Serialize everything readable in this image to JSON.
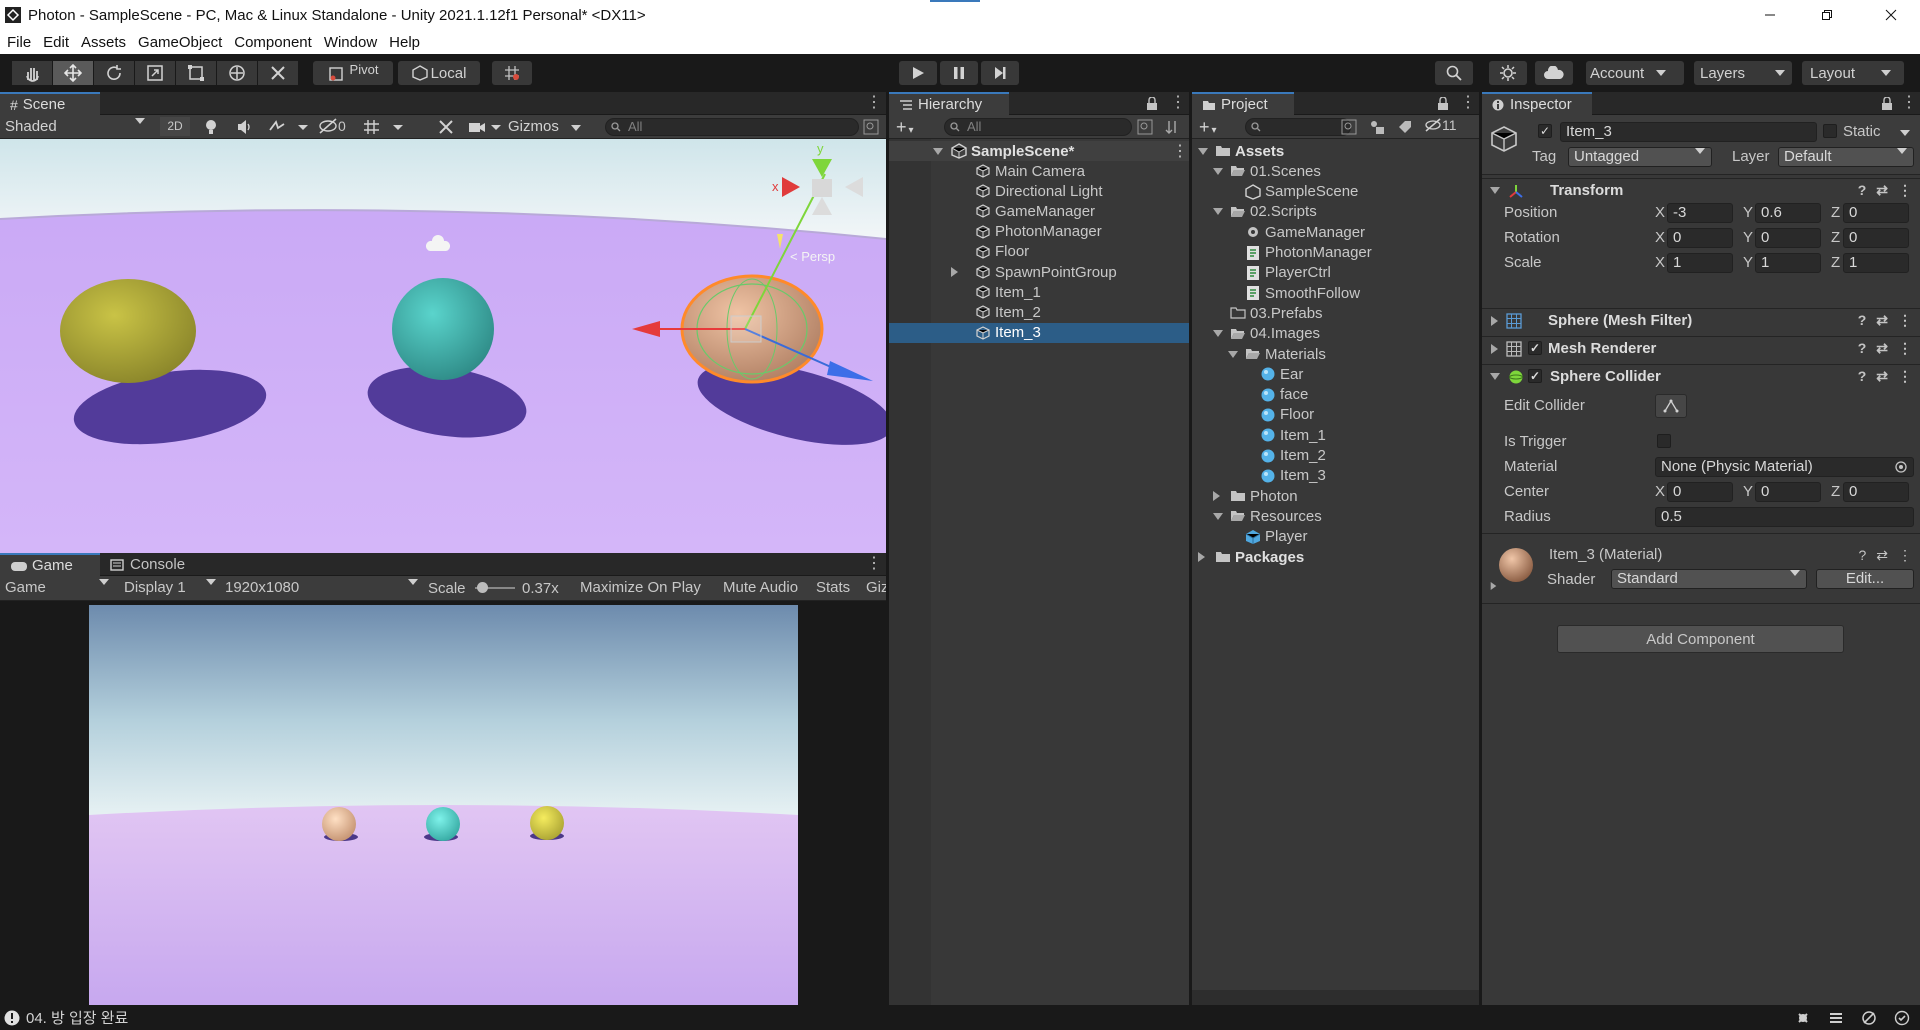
{
  "window": {
    "title": "Photon - SampleScene - PC, Mac & Linux Standalone - Unity 2021.1.12f1 Personal* <DX11>"
  },
  "menu": [
    "File",
    "Edit",
    "Assets",
    "GameObject",
    "Component",
    "Window",
    "Help"
  ],
  "toolbar": {
    "pivot_label": "Pivot",
    "space_label": "Local",
    "account_label": "Account",
    "layers_label": "Layers",
    "layout_label": "Layout"
  },
  "scene": {
    "tab_label": "Scene",
    "shading_mode": "Shaded",
    "mode_2d": "2D",
    "hidden_count": "0",
    "gizmos_label": "Gizmos",
    "search_placeholder": "All",
    "gizmo_y": "y",
    "gizmo_x": "x",
    "persp_label": "< Persp"
  },
  "game": {
    "tab_label": "Game",
    "console_tab_label": "Console",
    "view_mode": "Game",
    "display": "Display 1",
    "resolution": "1920x1080",
    "scale_label": "Scale",
    "scale_value": "0.37x",
    "maximize_label": "Maximize On Play",
    "mute_label": "Mute Audio",
    "stats_label": "Stats",
    "gizmos_label": "Giz"
  },
  "hierarchy": {
    "tab_label": "Hierarchy",
    "search_placeholder": "All",
    "scene_name": "SampleScene*",
    "items": [
      "Main Camera",
      "Directional Light",
      "GameManager",
      "PhotonManager",
      "Floor",
      "SpawnPointGroup",
      "Item_1",
      "Item_2",
      "Item_3"
    ],
    "selected": "Item_3"
  },
  "project": {
    "tab_label": "Project",
    "hidden_count": "11",
    "tree": [
      {
        "label": "Assets",
        "bold": true,
        "arrow": "dn",
        "icon": "folder-icon"
      },
      {
        "label": "01.Scenes",
        "arrow": "dn",
        "icon": "folder-open-icon"
      },
      {
        "label": "SampleScene",
        "icon": "unity-scene-icon"
      },
      {
        "label": "02.Scripts",
        "arrow": "dn",
        "icon": "folder-open-icon"
      },
      {
        "label": "GameManager",
        "icon": "gear-icon"
      },
      {
        "label": "PhotonManager",
        "icon": "script-icon"
      },
      {
        "label": "PlayerCtrl",
        "icon": "script-icon"
      },
      {
        "label": "SmoothFollow",
        "icon": "script-icon"
      },
      {
        "label": "03.Prefabs",
        "icon": "folder-empty-icon"
      },
      {
        "label": "04.Images",
        "arrow": "dn",
        "icon": "folder-open-icon"
      },
      {
        "label": "Materials",
        "arrow": "dn",
        "icon": "folder-open-icon"
      },
      {
        "label": "Ear",
        "icon": "material-icon"
      },
      {
        "label": "face",
        "icon": "material-icon"
      },
      {
        "label": "Floor",
        "icon": "material-icon"
      },
      {
        "label": "Item_1",
        "icon": "material-icon"
      },
      {
        "label": "Item_2",
        "icon": "material-icon"
      },
      {
        "label": "Item_3",
        "icon": "material-icon"
      },
      {
        "label": "Photon",
        "arrow": "rt",
        "icon": "folder-icon"
      },
      {
        "label": "Resources",
        "arrow": "dn",
        "icon": "folder-open-icon"
      },
      {
        "label": "Player",
        "icon": "prefab-icon"
      },
      {
        "label": "Packages",
        "bold": true,
        "arrow": "rt",
        "icon": "folder-icon"
      }
    ]
  },
  "inspector": {
    "tab_label": "Inspector",
    "object_name": "Item_3",
    "static_label": "Static",
    "tag_label": "Tag",
    "tag_value": "Untagged",
    "layer_label": "Layer",
    "layer_value": "Default",
    "transform": {
      "title": "Transform",
      "position_label": "Position",
      "rotation_label": "Rotation",
      "scale_label": "Scale",
      "axis_x": "X",
      "axis_y": "Y",
      "axis_z": "Z",
      "position": [
        "-3",
        "0.6",
        "0"
      ],
      "rotation": [
        "0",
        "0",
        "0"
      ],
      "scale": [
        "1",
        "1",
        "1"
      ]
    },
    "mesh_filter": "Sphere (Mesh Filter)",
    "mesh_renderer": "Mesh Renderer",
    "sphere_collider": {
      "title": "Sphere Collider",
      "edit_collider": "Edit Collider",
      "is_trigger": "Is Trigger",
      "material_label": "Material",
      "material_value": "None (Physic Material)",
      "center_label": "Center",
      "center": [
        "0",
        "0",
        "0"
      ],
      "radius_label": "Radius",
      "radius": "0.5"
    },
    "material": {
      "title": "Item_3 (Material)",
      "shader_label": "Shader",
      "shader_value": "Standard",
      "edit_label": "Edit..."
    },
    "add_component": "Add Component"
  },
  "status": {
    "message": "04. 방 입장 완료"
  },
  "colors": {
    "selection": "#2c5d87",
    "panel": "#383838",
    "toolbar": "#191919",
    "ball_yellow": "#c9c346",
    "ball_cyan": "#4fc6c0",
    "ball_peach": "#e8b08f"
  }
}
